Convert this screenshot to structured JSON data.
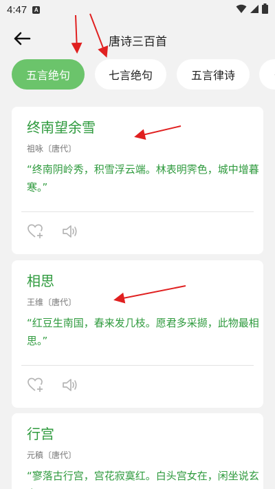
{
  "status_bar": {
    "time": "4:47",
    "notification_badge": "A"
  },
  "header": {
    "title": "唐诗三百首"
  },
  "tabs": [
    {
      "label": "五言绝句",
      "active": true
    },
    {
      "label": "七言绝句",
      "active": false
    },
    {
      "label": "五言律诗",
      "active": false
    },
    {
      "label": "七",
      "active": false
    }
  ],
  "poems": [
    {
      "title": "终南望余雪",
      "author": "祖咏〔唐代〕",
      "text": "“终南阴岭秀，积雪浮云端。林表明霁色，城中增暮寒。”"
    },
    {
      "title": "相思",
      "author": "王维〔唐代〕",
      "text": "“红豆生南国，春来发几枝。愿君多采撷，此物最相思。”"
    },
    {
      "title": "行宫",
      "author": "元稹〔唐代〕",
      "text": "“寥落古行宫，宫花寂寞红。白头宫女在，闲坐说玄宗。”"
    }
  ],
  "colors": {
    "accent": "#6bc46b",
    "poem_green": "#2e9a3d",
    "annotation_red": "#e02020",
    "background": "#f2f2f2"
  }
}
